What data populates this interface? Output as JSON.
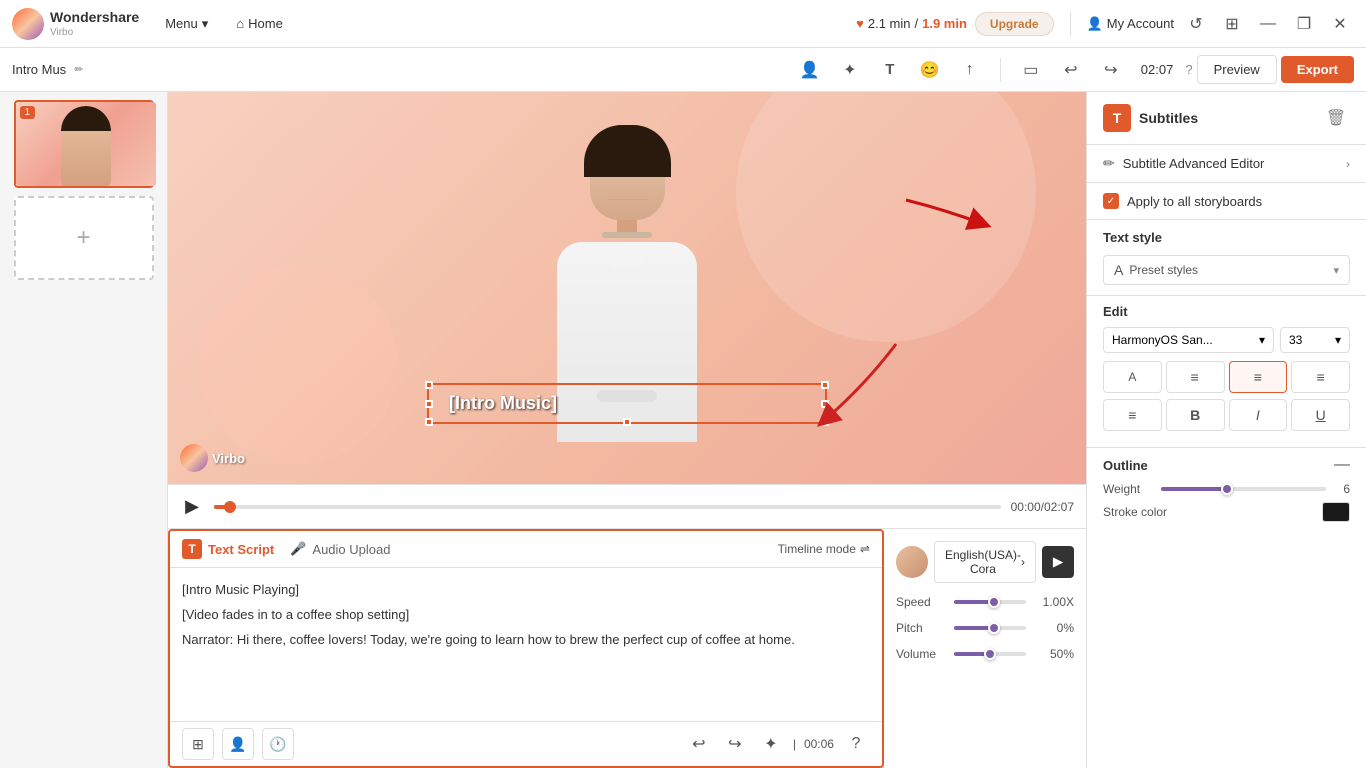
{
  "app": {
    "name": "Wondershare",
    "product": "Virbo"
  },
  "topbar": {
    "menu_label": "Menu",
    "home_label": "Home",
    "duration_used": "2.1 min",
    "duration_slash": "/",
    "duration_limit": "1.9 min",
    "upgrade_label": "Upgrade",
    "account_label": "My Account",
    "window_minimize": "—",
    "window_restore": "❐",
    "window_close": "✕"
  },
  "toolbar2": {
    "tab_title": "Intro Mus",
    "time_display": "02:07",
    "preview_label": "Preview",
    "export_label": "Export"
  },
  "left_panel": {
    "add_slide_label": "+"
  },
  "video_preview": {
    "subtitle_text": "[Intro Music]",
    "watermark": "Virbo"
  },
  "playback": {
    "time_current": "00:00",
    "time_total": "02:07"
  },
  "script_area": {
    "tab_text_script": "Text Script",
    "tab_audio_upload": "Audio Upload",
    "timeline_mode": "Timeline mode",
    "lines": [
      "[Intro Music Playing]",
      "[Video fades in to a coffee shop setting]",
      "Narrator: Hi there, coffee lovers! Today, we're going to learn how to brew the perfect cup of coffee at home."
    ],
    "time_badge": "00:06"
  },
  "audio_panel": {
    "voice_name": "English(USA)-Cora",
    "speed_label": "Speed",
    "speed_value": "1.00X",
    "speed_percent": 55,
    "pitch_label": "Pitch",
    "pitch_value": "0%",
    "pitch_percent": 55,
    "volume_label": "Volume",
    "volume_value": "50%",
    "volume_percent": 50
  },
  "right_panel": {
    "title": "Subtitles",
    "subtitle_advanced_label": "Subtitle Advanced Editor",
    "apply_all_label": "Apply to all storyboards",
    "text_style_label": "Text style",
    "preset_styles_label": "Preset styles",
    "edit_label": "Edit",
    "font_name": "HarmonyOS San...",
    "font_size": "33",
    "outline_label": "Outline",
    "weight_label": "Weight",
    "weight_value": "6",
    "stroke_color_label": "Stroke color"
  },
  "icons": {
    "play": "▶",
    "pause": "⏸",
    "undo": "↩",
    "redo": "↪",
    "chevron_down": "▾",
    "chevron_right": "›",
    "check": "✓",
    "bold": "B",
    "italic": "I",
    "underline": "U",
    "align_left": "≡",
    "align_center": "≡",
    "align_right": "≡",
    "align_justify": "≡",
    "list_indent": "≡",
    "microphone": "🎤",
    "clock": "🕐",
    "text_icon": "T",
    "trash": "🗑",
    "pencil": "✏",
    "minus": "—",
    "home": "⌂",
    "user": "👤",
    "reset": "↺",
    "grid": "⊞",
    "film": "▭",
    "sticker": "😊",
    "arrow_up": "↑",
    "heart": "♥",
    "magic_wand": "✦",
    "subscript": "T₁"
  }
}
